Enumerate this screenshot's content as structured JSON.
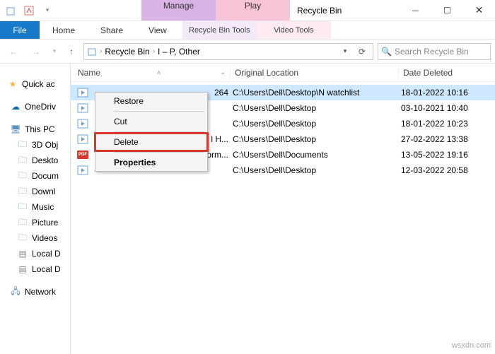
{
  "title": "Recycle Bin",
  "context_tabs": {
    "manage": "Manage",
    "play": "Play",
    "manage_sub": "Recycle Bin Tools",
    "play_sub": "Video Tools"
  },
  "tabs": {
    "file": "File",
    "home": "Home",
    "share": "Share",
    "view": "View"
  },
  "breadcrumb": {
    "root": "Recycle Bin",
    "sub": "I – P, Other"
  },
  "search_placeholder": "Search Recycle Bin",
  "tree": {
    "quick": "Quick ac",
    "onedrive": "OneDriv",
    "thispc": "This PC",
    "items": [
      "3D Obj",
      "Deskto",
      "Docum",
      "Downl",
      "Music",
      "Picture",
      "Videos",
      "Local D",
      "Local D"
    ],
    "network": "Network"
  },
  "columns": {
    "name": "Name",
    "orig": "Original Location",
    "date": "Date Deleted"
  },
  "rows": [
    {
      "icon": "video",
      "name": "",
      "suffix": "264",
      "orig": "C:\\Users\\Dell\\Desktop\\N watchlist",
      "date": "18-01-2022 10:16",
      "selected": true
    },
    {
      "icon": "video",
      "name": "",
      "suffix": "",
      "orig": "C:\\Users\\Dell\\Desktop",
      "date": "03-10-2021 10:40"
    },
    {
      "icon": "video",
      "name": "",
      "suffix": "",
      "orig": "C:\\Users\\Dell\\Desktop",
      "date": "18-01-2022 10:23"
    },
    {
      "icon": "video",
      "name": "",
      "suffix": "l H...",
      "orig": "C:\\Users\\Dell\\Desktop",
      "date": "27-02-2022 13:38"
    },
    {
      "icon": "pdf",
      "name": "",
      "suffix": "orm...",
      "orig": "C:\\Users\\Dell\\Documents",
      "date": "13-05-2022 19:16"
    },
    {
      "icon": "video",
      "name": "",
      "suffix": "",
      "orig": "C:\\Users\\Dell\\Desktop",
      "date": "12-03-2022 20:58"
    }
  ],
  "context_menu": {
    "restore": "Restore",
    "cut": "Cut",
    "delete": "Delete",
    "properties": "Properties"
  },
  "watermark": "wsxdn.com"
}
